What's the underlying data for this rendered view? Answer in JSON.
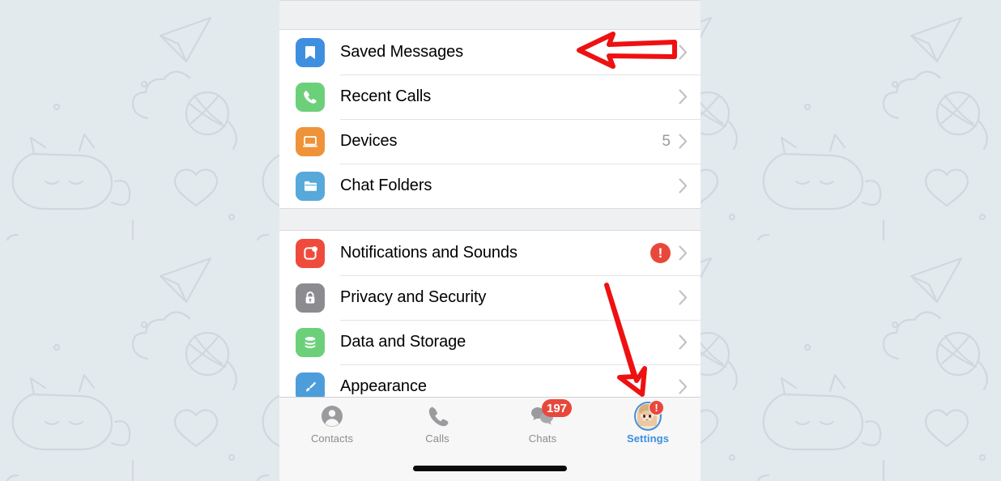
{
  "app": {
    "name": "Telegram",
    "screen": "Settings",
    "background_color": "#e3eaee",
    "accent_color": "#3d8fe0",
    "badge_color": "#e8483c"
  },
  "sections": [
    {
      "id": "chats-section",
      "rows": [
        {
          "label": "Saved Messages",
          "icon": "bookmark-icon",
          "icon_color": "#3f8fe0",
          "value": "",
          "alert": false,
          "chevron": "chevron-right-icon"
        },
        {
          "label": "Recent Calls",
          "icon": "phone-icon",
          "icon_color": "#6cd07a",
          "value": "",
          "alert": false,
          "chevron": "chevron-right-icon"
        },
        {
          "label": "Devices",
          "icon": "laptop-icon",
          "icon_color": "#ef9338",
          "value": "5",
          "alert": false,
          "chevron": "chevron-right-icon"
        },
        {
          "label": "Chat Folders",
          "icon": "folder-icon",
          "icon_color": "#56a9d9",
          "value": "",
          "alert": false,
          "chevron": "chevron-right-icon"
        }
      ]
    },
    {
      "id": "preferences-section",
      "rows": [
        {
          "label": "Notifications and Sounds",
          "icon": "notification-icon",
          "icon_color": "#ef4b3c",
          "value": "",
          "alert": true,
          "alert_glyph": "!",
          "chevron": "chevron-right-icon"
        },
        {
          "label": "Privacy and Security",
          "icon": "lock-icon",
          "icon_color": "#8c8c90",
          "value": "",
          "alert": false,
          "chevron": "chevron-right-icon"
        },
        {
          "label": "Data and Storage",
          "icon": "database-icon",
          "icon_color": "#6cd07a",
          "value": "",
          "alert": false,
          "chevron": "chevron-right-icon"
        },
        {
          "label": "Appearance",
          "icon": "paintbrush-icon",
          "icon_color": "#4d9ddb",
          "value": "",
          "alert": false,
          "chevron": "chevron-right-icon"
        }
      ]
    }
  ],
  "tabbar": {
    "tabs": [
      {
        "label": "Contacts",
        "icon": "person-circle-icon",
        "active": false,
        "badge": ""
      },
      {
        "label": "Calls",
        "icon": "phone-handset-icon",
        "active": false,
        "badge": ""
      },
      {
        "label": "Chats",
        "icon": "chat-bubbles-icon",
        "active": false,
        "badge": "197"
      },
      {
        "label": "Settings",
        "icon": "avatar-icon",
        "active": true,
        "badge": "!"
      }
    ]
  },
  "annotations": [
    {
      "id": "arrow-saved-messages",
      "shape": "left-pointing-outlined-arrow",
      "color": "#ee1111",
      "points_to": "Saved Messages"
    },
    {
      "id": "arrow-settings-tab",
      "shape": "down-right-pointing-outlined-arrow",
      "color": "#ee1111",
      "points_to": "Settings"
    }
  ]
}
